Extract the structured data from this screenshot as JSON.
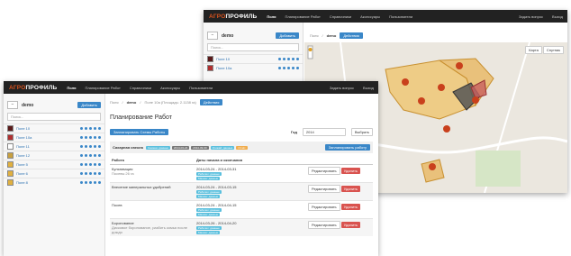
{
  "app": {
    "logo_a": "АГРО",
    "logo_b": "ПРОФИЛЬ",
    "nav": [
      "Поля",
      "Планирование Работ",
      "Справочники",
      "Аксессуары",
      "Пользователи"
    ],
    "right_nav": [
      "Задать вопрос",
      "Выход"
    ]
  },
  "back_window": {
    "farm_name": "demo",
    "add_button": "Добавить",
    "search_placeholder": "Поиск...",
    "crumbs": [
      "Поля",
      "demo"
    ],
    "actions_button": "Действия",
    "fields": [
      {
        "name": "Поле 10",
        "color": "#5a1a1a"
      },
      {
        "name": "Поле 10a",
        "color": "#b03030"
      }
    ],
    "map_controls": [
      "Карта",
      "Спутник"
    ]
  },
  "front_window": {
    "farm_name": "demo",
    "add_button": "Добавить",
    "search_placeholder": "Поиск...",
    "crumbs": [
      "Поля",
      "demo",
      "Поле 10а (Площадь: 2.1138 га)"
    ],
    "actions_button": "Действия",
    "page_title": "Планирование Работ",
    "plan_button": "Запланировать Схемы Работы",
    "year_label": "Год",
    "year_value": "2014",
    "select_button": "Выбрать",
    "crop_label": "Сахарная свекла",
    "crop_tags": [
      "Семена: данные",
      "2014-03-24",
      "2014-09-30",
      "Урожай: данные",
      "Отчёт"
    ],
    "add_work_button": "Запланировать работу",
    "table_headers": [
      "Работа",
      "Даты начала и окончания",
      ""
    ],
    "fields": [
      {
        "name": "Поле 10",
        "color": "#5a1a1a"
      },
      {
        "name": "Поле 10а",
        "color": "#b03030"
      },
      {
        "name": "Поле 11",
        "color": "#ffffff"
      },
      {
        "name": "Поле 12",
        "color": "#c8a040"
      },
      {
        "name": "Поле 5",
        "color": "#e0b040"
      },
      {
        "name": "Поле 6",
        "color": "#e0b040"
      },
      {
        "name": "Поле 8",
        "color": "#e0b040"
      }
    ],
    "rows": [
      {
        "work": "Культивация",
        "sub": "Посевы 26 га",
        "dates": "2014-03-24 - 2014-03-31",
        "tags": [
          "Рабочих: данные",
          "Машин: данные"
        ]
      },
      {
        "work": "Внесение минеральных удобрений",
        "sub": "",
        "dates": "2014-03-24 - 2014-03-15",
        "tags": [
          "Рабочих: данные",
          "Машин: данные"
        ]
      },
      {
        "work": "Посев",
        "sub": "",
        "dates": "2014-03-24 - 2014-04-15",
        "tags": [
          "Рабочих: данные",
          "Машин: данные"
        ]
      },
      {
        "work": "Боронование",
        "sub": "Дисковое боронование, разбить комья после дождя",
        "dates": "2014-03-26 - 2014-04-20",
        "tags": [
          "Рабочих: данные",
          "Машин: данные"
        ]
      }
    ],
    "edit_label": "Редактировать",
    "delete_label": "Удалить"
  }
}
